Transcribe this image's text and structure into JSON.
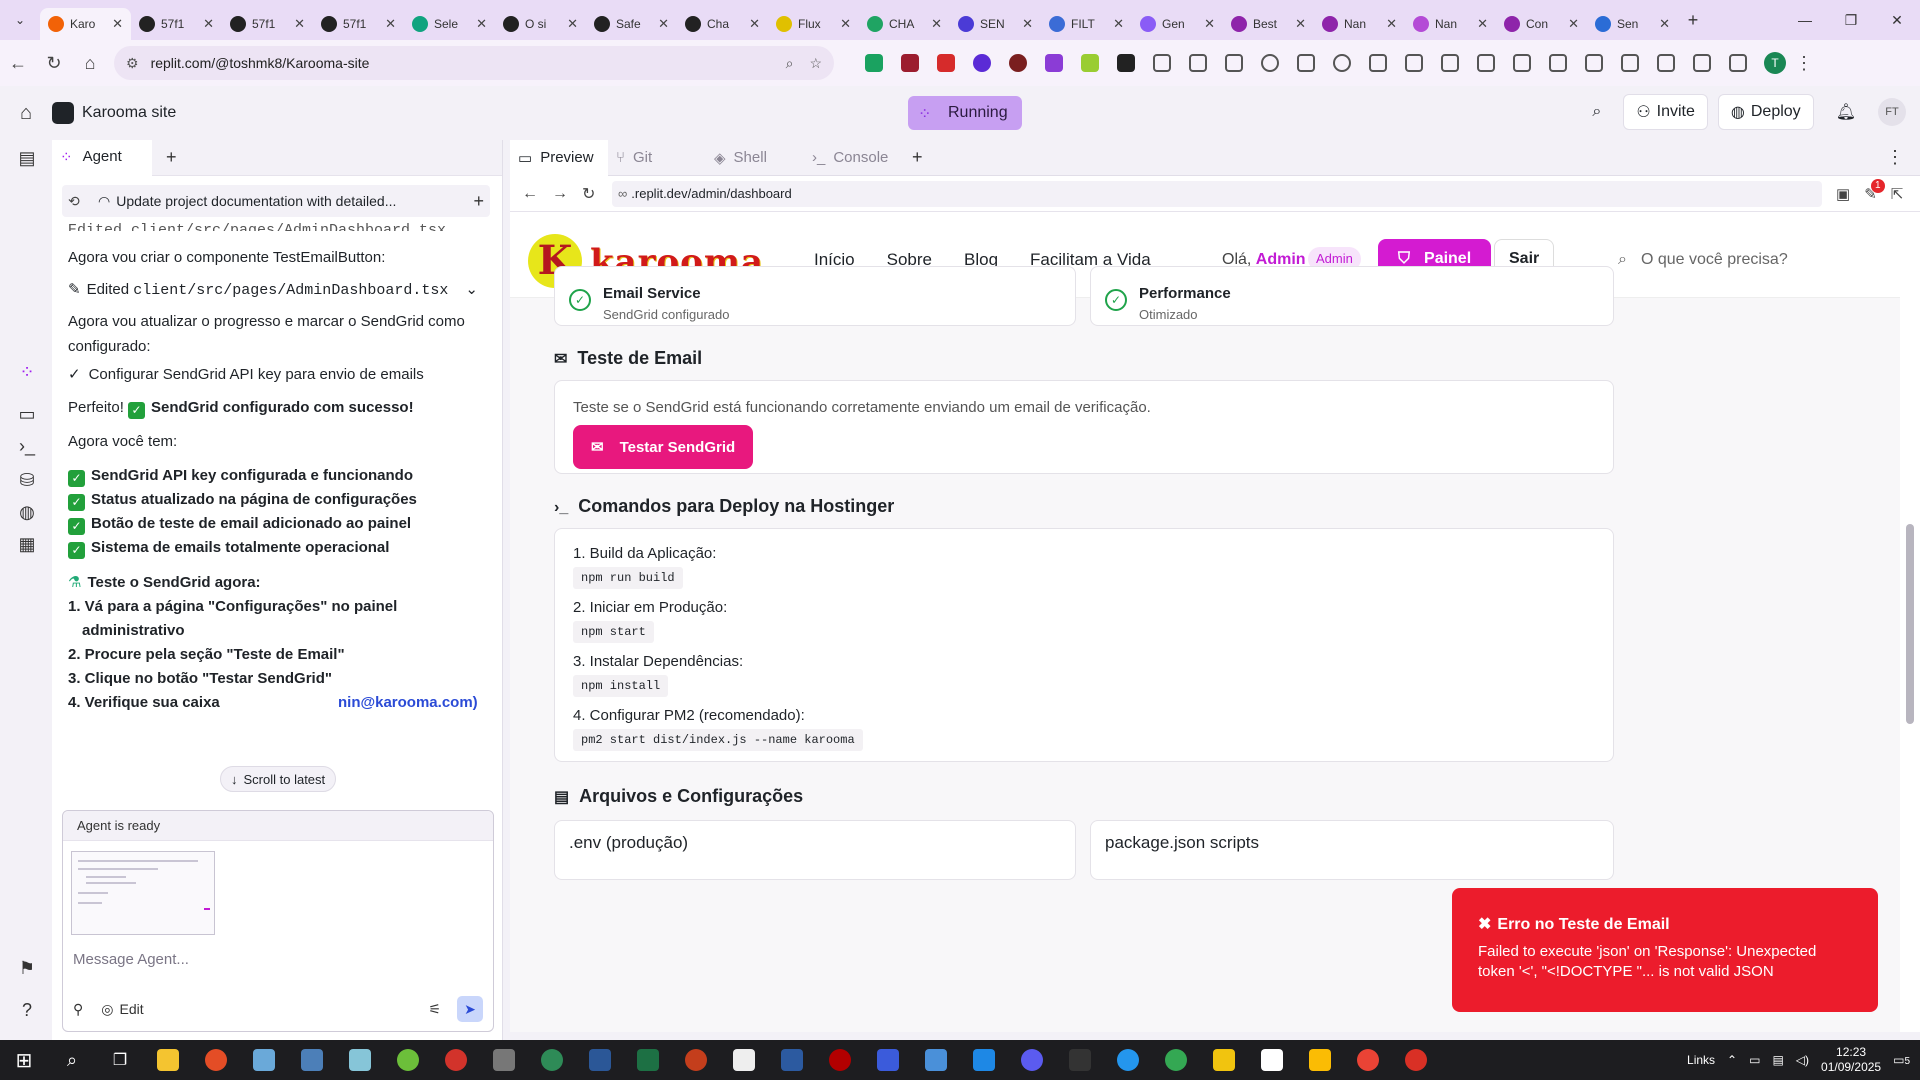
{
  "browser": {
    "tabs": [
      {
        "title": "Karo",
        "color": "#f26207",
        "active": true
      },
      {
        "title": "57f1",
        "color": "#222222"
      },
      {
        "title": "57f1",
        "color": "#222222"
      },
      {
        "title": "57f1",
        "color": "#222222"
      },
      {
        "title": "Sele",
        "color": "#10a37f"
      },
      {
        "title": "O si",
        "color": "#222222"
      },
      {
        "title": "Safe",
        "color": "#222222"
      },
      {
        "title": "Cha",
        "color": "#222222"
      },
      {
        "title": "Flux",
        "color": "#e0c000"
      },
      {
        "title": "CHA",
        "color": "#1fa463"
      },
      {
        "title": "SEN",
        "color": "#4b3bd6"
      },
      {
        "title": "FILT",
        "color": "#3b6cd6"
      },
      {
        "title": "Gen",
        "color": "#8a5cf6"
      },
      {
        "title": "Best",
        "color": "#8e24aa"
      },
      {
        "title": "Nan",
        "color": "#8e24aa"
      },
      {
        "title": "Nan",
        "color": "#b44bd6"
      },
      {
        "title": "Con",
        "color": "#8e24aa"
      },
      {
        "title": "Sen",
        "color": "#2b6cd6"
      }
    ],
    "url": "replit.com/@toshmk8/Karooma-site",
    "profile_initial": "T"
  },
  "replit": {
    "project_name": "Karooma site",
    "status": "Running",
    "invite_label": "Invite",
    "deploy_label": "Deploy",
    "avatar_initials": "FT"
  },
  "agent": {
    "tab_label": "Agent",
    "history_title": "Update project documentation with detailed...",
    "messages": {
      "m0": "Edited client/src/pages/AdminDashboard.tsx",
      "m1": "Agora vou criar o componente TestEmailButton:",
      "m2_prefix": "Edited ",
      "m2_path": "client/src/pages/AdminDashboard.tsx",
      "m3": "Agora vou atualizar o progresso e marcar o SendGrid como configurado:",
      "m4": "Configurar SendGrid API key para envio de emails",
      "m5_prefix": "Perfeito!",
      "m5_bold": "SendGrid configurado com sucesso!",
      "m6": "Agora você tem:",
      "checks": [
        "SendGrid API key configurada e funcionando",
        "Status atualizado na página de configurações",
        "Botão de teste de email adicionado ao painel",
        "Sistema de emails totalmente operacional"
      ],
      "test_heading": "Teste o SendGrid agora:",
      "steps": [
        "1. Vá para a página \"Configurações\" no painel",
        "administrativo",
        "2. Procure pela seção \"Teste de Email\"",
        "3. Clique no botão \"Testar SendGrid\"",
        "4. Verifique sua caixa"
      ],
      "step4_link": "nin@karooma.com)"
    },
    "scroll_latest": "Scroll to latest",
    "ready_status": "Agent is ready",
    "message_placeholder": "Message Agent...",
    "edit_label": "Edit"
  },
  "preview": {
    "tabs": [
      "Preview",
      "Git",
      "Shell",
      "Console"
    ],
    "url": ".replit.dev/admin/dashboard",
    "notif_count": "1"
  },
  "site": {
    "logo_letter": "K",
    "logo_text": "karooma",
    "menu": [
      "Início",
      "Sobre",
      "Blog",
      "Facilitam a Vida"
    ],
    "greeting": "Olá,",
    "user_name": "Admin",
    "role_badge": "Admin",
    "painel_label": "Painel",
    "sair_label": "Sair",
    "search_placeholder": "O que você precisa?",
    "services": [
      {
        "title": "Email Service",
        "sub": "SendGrid configurado"
      },
      {
        "title": "Performance",
        "sub": "Otimizado"
      }
    ],
    "email_section_title": "Teste de Email",
    "email_desc": "Teste se o SendGrid está funcionando corretamente enviando um email de verificação.",
    "test_button": "Testar SendGrid",
    "deploy_section_title": "Comandos para Deploy na Hostinger",
    "commands": [
      {
        "label": "1. Build da Aplicação:",
        "code": "npm run build"
      },
      {
        "label": "2. Iniciar em Produção:",
        "code": "npm start"
      },
      {
        "label": "3. Instalar Dependências:",
        "code": "npm install"
      },
      {
        "label": "4. Configurar PM2 (recomendado):",
        "code": "pm2 start dist/index.js --name karooma"
      }
    ],
    "files_section_title": "Arquivos e Configurações",
    "file_cards": [
      ".env (produção)",
      "package.json scripts"
    ]
  },
  "toast": {
    "title": "Erro no Teste de Email",
    "message": "Failed to execute 'json' on 'Response': Unexpected token '<', \"<!DOCTYPE \"... is not valid JSON"
  },
  "taskbar": {
    "links_label": "Links",
    "time": "12:23",
    "date": "01/09/2025",
    "notif_count": "5"
  }
}
